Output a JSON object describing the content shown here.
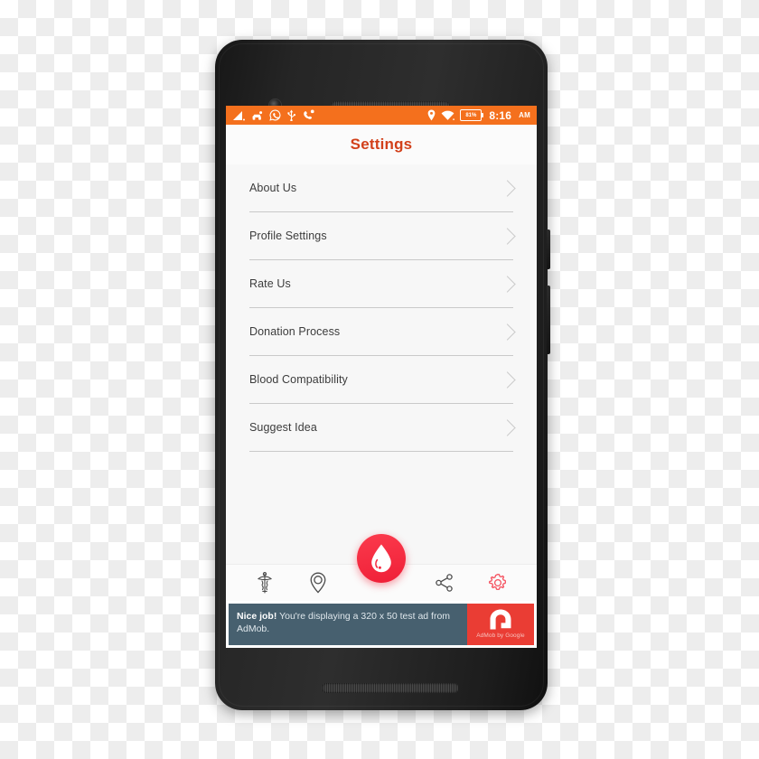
{
  "device": {
    "type": "android-smartphone",
    "front_camera": "front-camera",
    "earpiece": "earpiece-speaker-grille",
    "bottom_speaker": "bottom-speaker-grille",
    "power_button": "power-button",
    "volume_button": "volume-button"
  },
  "status_bar": {
    "background_color": "#f4701d",
    "left_icons": [
      {
        "name": "signal-bars-icon",
        "label": "signal"
      },
      {
        "name": "driving-mode-icon",
        "label": "driving mode"
      },
      {
        "name": "whatsapp-icon",
        "label": "WhatsApp"
      },
      {
        "name": "usb-icon",
        "label": "USB"
      },
      {
        "name": "missed-call-icon",
        "label": "call"
      }
    ],
    "right_icons": [
      {
        "name": "location-pin-icon",
        "label": "location"
      },
      {
        "name": "wifi-icon",
        "label": "wifi"
      }
    ],
    "battery_percent": "81%",
    "time": "8:16",
    "meridiem": "AM"
  },
  "app_bar": {
    "title": "Settings",
    "title_color": "#d2401a"
  },
  "settings_list": [
    {
      "label": "About Us",
      "chevron": "chevron-right-icon"
    },
    {
      "label": "Profile Settings",
      "chevron": "chevron-right-icon"
    },
    {
      "label": "Rate Us",
      "chevron": "chevron-right-icon"
    },
    {
      "label": "Donation Process",
      "chevron": "chevron-right-icon"
    },
    {
      "label": "Blood Compatibility",
      "chevron": "chevron-right-icon"
    },
    {
      "label": "Suggest Idea",
      "chevron": "chevron-right-icon"
    }
  ],
  "bottom_nav": {
    "items": [
      {
        "name": "caduceus-icon",
        "label": "Medical",
        "active": false
      },
      {
        "name": "location-pin-icon",
        "label": "Location",
        "active": false
      },
      {
        "name": "share-icon",
        "label": "Share",
        "active": false
      },
      {
        "name": "gear-icon",
        "label": "Settings",
        "active": true
      }
    ],
    "active_color": "#f5515f",
    "inactive_color": "#4a4a4a",
    "fab": {
      "name": "blood-drop-icon",
      "label": "Donate",
      "color": "#f42a40"
    }
  },
  "ad_banner": {
    "headline": "Nice job!",
    "body": " You're displaying a 320 x 50 test ad from AdMob.",
    "logo_caption": "AdMob by Google",
    "logo_color": "#ea3d34",
    "background_color": "#47606f"
  }
}
